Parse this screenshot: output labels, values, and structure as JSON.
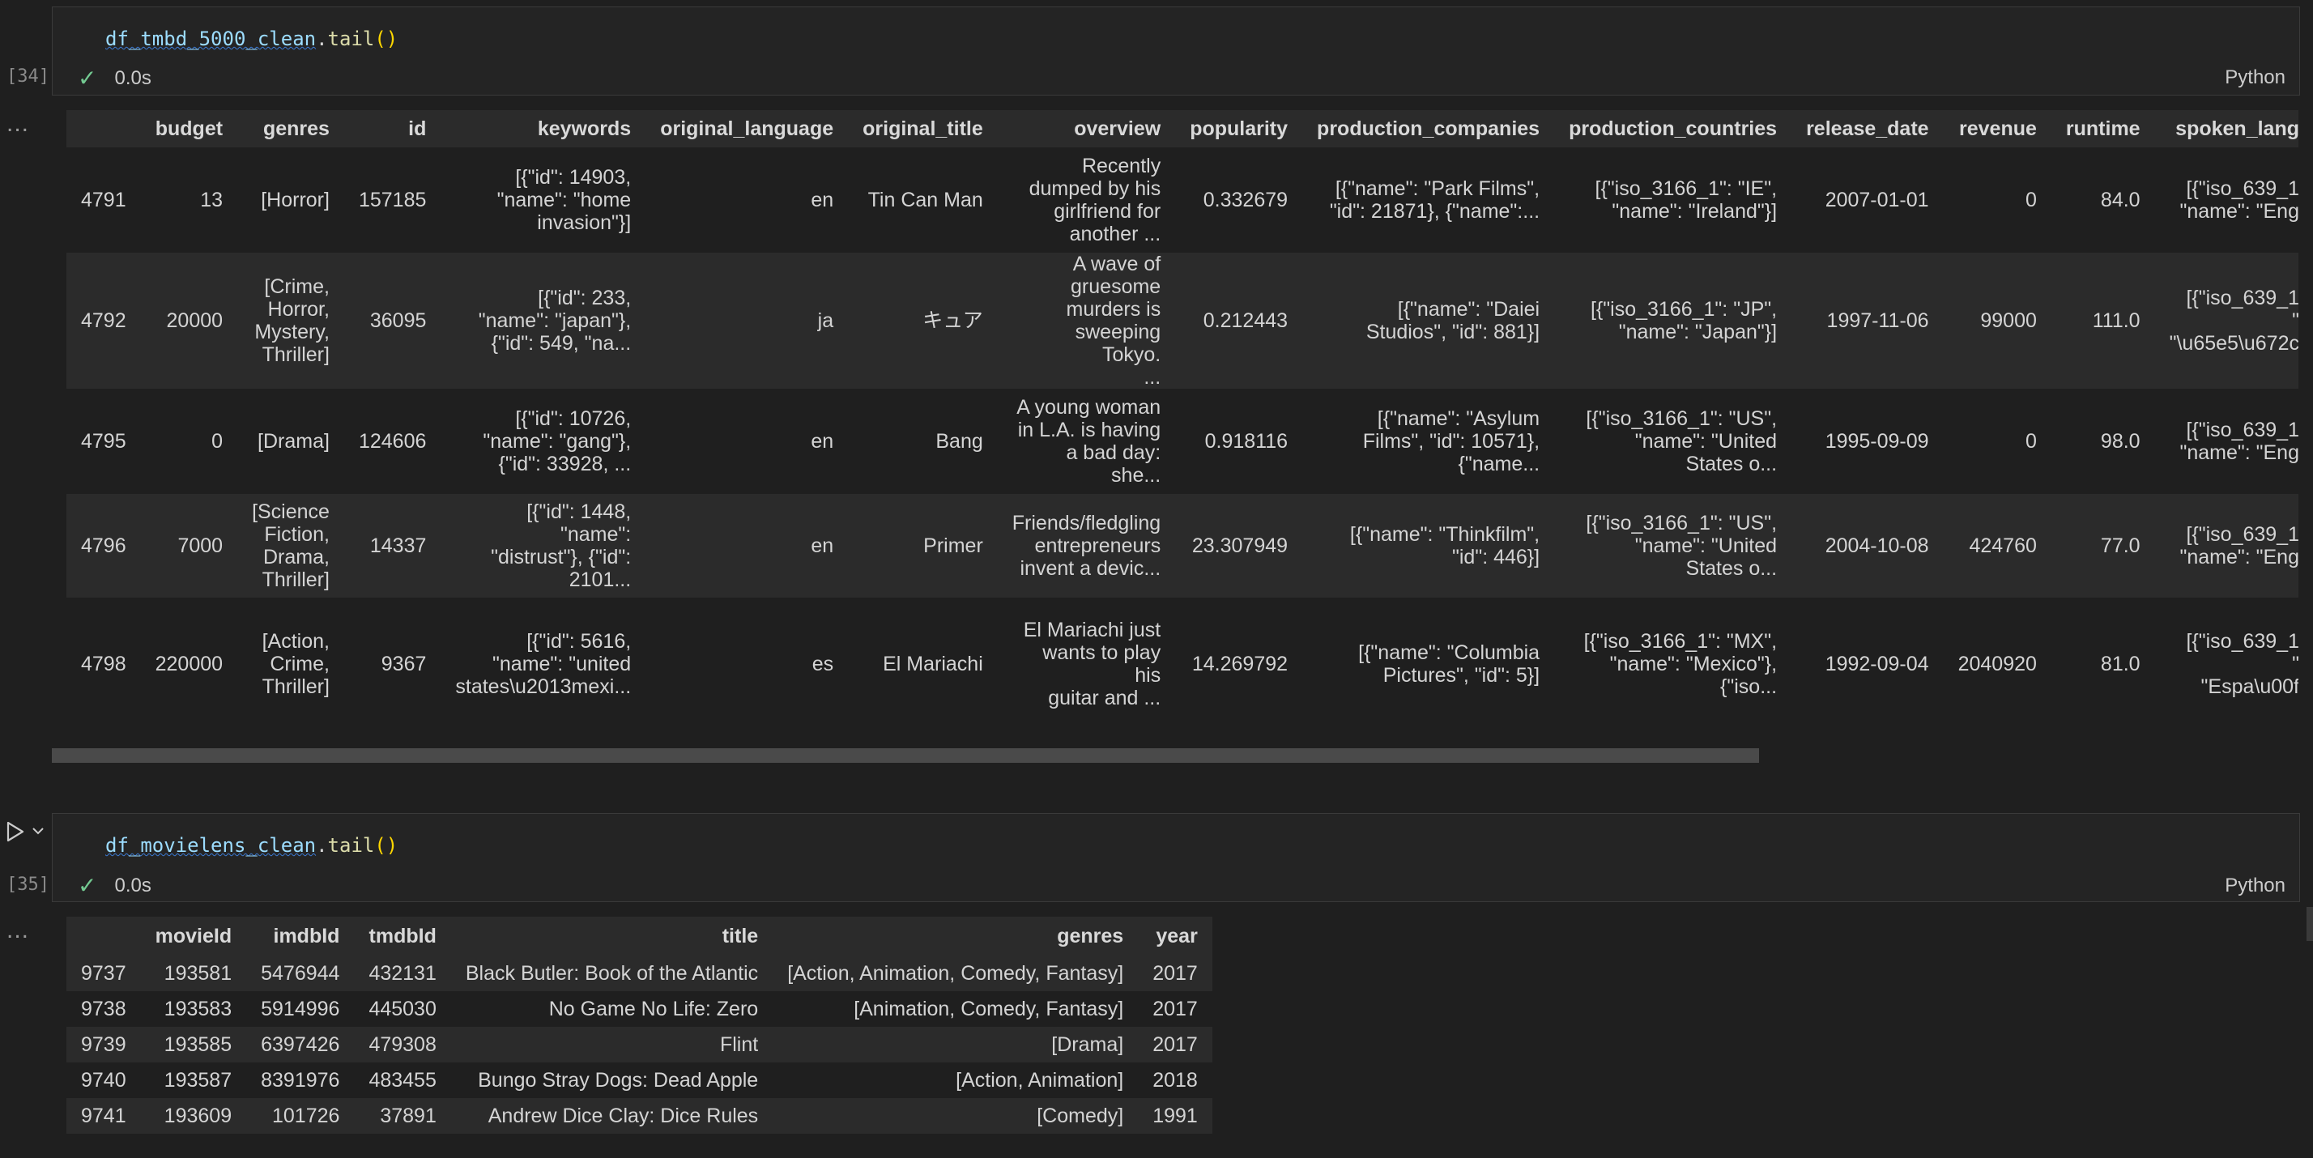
{
  "cell1": {
    "exec_count": "[34]",
    "code_var": "df_tmbd_5000_clean",
    "code_method": "tail",
    "time": "0.0s",
    "language": "Python",
    "columns": [
      "",
      "budget",
      "genres",
      "id",
      "keywords",
      "original_language",
      "original_title",
      "overview",
      "popularity",
      "production_companies",
      "production_countries",
      "release_date",
      "revenue",
      "runtime",
      "spoken_lang"
    ],
    "rows": [
      [
        "4791",
        "13",
        "[Horror]",
        "157185",
        "[{\"id\": 14903,\n\"name\": \"home\ninvasion\"}]",
        "en",
        "Tin Can Man",
        "Recently\ndumped by his\ngirlfriend for\nanother ...",
        "0.332679",
        "[{\"name\": \"Park Films\",\n\"id\": 21871}, {\"name\":...",
        "[{\"iso_3166_1\": \"IE\",\n\"name\": \"Ireland\"}]",
        "2007-01-01",
        "0",
        "84.0",
        "[{\"iso_639_1\n\"name\": \"Eng"
      ],
      [
        "4792",
        "20000",
        "[Crime,\nHorror,\nMystery,\nThriller]",
        "36095",
        "[{\"id\": 233,\n\"name\": \"japan\"},\n{\"id\": 549, \"na...",
        "ja",
        "キュア",
        "A wave of\ngruesome\nmurders is\nsweeping Tokyo.\n...",
        "0.212443",
        "[{\"name\": \"Daiei\nStudios\", \"id\": 881}]",
        "[{\"iso_3166_1\": \"JP\",\n\"name\": \"Japan\"}]",
        "1997-11-06",
        "99000",
        "111.0",
        "[{\"iso_639_1\n\"\n\"\\u65e5\\u672c"
      ],
      [
        "4795",
        "0",
        "[Drama]",
        "124606",
        "[{\"id\": 10726,\n\"name\": \"gang\"},\n{\"id\": 33928, ...",
        "en",
        "Bang",
        "A young woman\nin L.A. is having\na bad day: she...",
        "0.918116",
        "[{\"name\": \"Asylum\nFilms\", \"id\": 10571},\n{\"name...",
        "[{\"iso_3166_1\": \"US\",\n\"name\": \"United\nStates o...",
        "1995-09-09",
        "0",
        "98.0",
        "[{\"iso_639_1\n\"name\": \"Eng"
      ],
      [
        "4796",
        "7000",
        "[Science\nFiction,\nDrama,\nThriller]",
        "14337",
        "[{\"id\": 1448,\n\"name\":\n\"distrust\"}, {\"id\":\n2101...",
        "en",
        "Primer",
        "Friends/fledgling\nentrepreneurs\ninvent a devic...",
        "23.307949",
        "[{\"name\": \"Thinkfilm\",\n\"id\": 446}]",
        "[{\"iso_3166_1\": \"US\",\n\"name\": \"United\nStates o...",
        "2004-10-08",
        "424760",
        "77.0",
        "[{\"iso_639_1\n\"name\": \"Eng"
      ],
      [
        "4798",
        "220000",
        "[Action,\nCrime,\nThriller]",
        "9367",
        "[{\"id\": 5616,\n\"name\": \"united\nstates\\u2013mexi...",
        "es",
        "El Mariachi",
        "El Mariachi just\nwants to play his\nguitar and ...",
        "14.269792",
        "[{\"name\": \"Columbia\nPictures\", \"id\": 5}]",
        "[{\"iso_3166_1\": \"MX\",\n\"name\": \"Mexico\"},\n{\"iso...",
        "1992-09-04",
        "2040920",
        "81.0",
        "[{\"iso_639_1\n\"\n\"Espa\\u00f"
      ]
    ]
  },
  "cell2": {
    "exec_count": "[35]",
    "code_var": "df_movielens_clean",
    "code_method": "tail",
    "time": "0.0s",
    "language": "Python",
    "columns": [
      "",
      "movieId",
      "imdbId",
      "tmdbId",
      "title",
      "genres",
      "year"
    ],
    "rows": [
      [
        "9737",
        "193581",
        "5476944",
        "432131",
        "Black Butler: Book of the Atlantic",
        "[Action, Animation, Comedy, Fantasy]",
        "2017"
      ],
      [
        "9738",
        "193583",
        "5914996",
        "445030",
        "No Game No Life: Zero",
        "[Animation, Comedy, Fantasy]",
        "2017"
      ],
      [
        "9739",
        "193585",
        "6397426",
        "479308",
        "Flint",
        "[Drama]",
        "2017"
      ],
      [
        "9740",
        "193587",
        "8391976",
        "483455",
        "Bungo Stray Dogs: Dead Apple",
        "[Action, Animation]",
        "2018"
      ],
      [
        "9741",
        "193609",
        "101726",
        "37891",
        "Andrew Dice Clay: Dice Rules",
        "[Comedy]",
        "1991"
      ]
    ]
  },
  "ui": {
    "output_menu": "...",
    "accent_check": "#73c991"
  }
}
